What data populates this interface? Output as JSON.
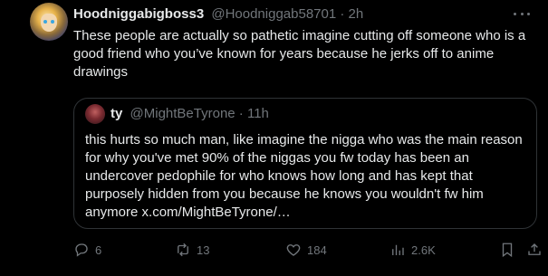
{
  "post": {
    "display_name": "Hoodniggabigboss3",
    "handle": "@Hoodniggab58701",
    "separator": " · ",
    "time": "2h",
    "text": "These people are actually so pathetic imagine cutting off someone who is a good friend who you’ve known for years because he jerks off to anime drawings"
  },
  "quoted": {
    "display_name": "ty",
    "handle": "@MightBeTyrone",
    "separator": " · ",
    "time": "11h",
    "text": "this hurts so much man, like imagine the nigga who was the main reason for why you've met 90% of the niggas you fw today has been an undercover pedophile for who knows how long and has kept that purposely hidden from you because he knows you wouldn't fw him anymore x.com/MightBeTyrone/…"
  },
  "actions": {
    "replies": "6",
    "reposts": "13",
    "likes": "184",
    "views": "2.6K"
  },
  "icons": [
    "more-icon",
    "reply-icon",
    "repost-icon",
    "like-icon",
    "views-icon",
    "bookmark-icon",
    "share-icon"
  ],
  "colors": {
    "background": "#000000",
    "text": "#e7e9ea",
    "muted": "#71767b",
    "border": "#2f3336"
  }
}
